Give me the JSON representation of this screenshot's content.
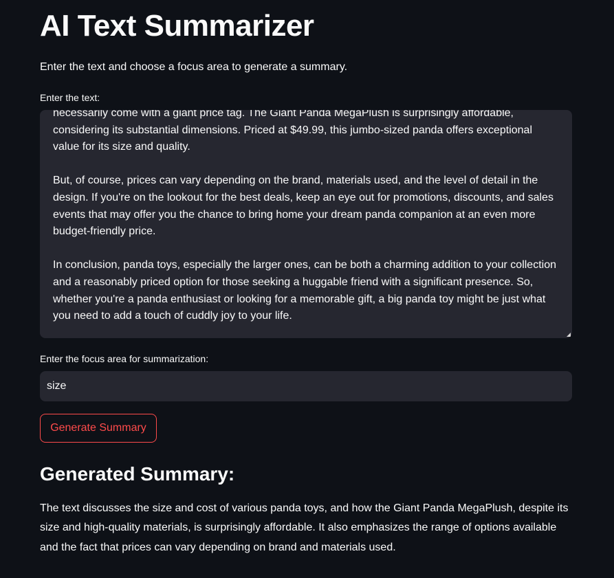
{
  "app": {
    "title": "AI Text Summarizer",
    "intro": "Enter the text and choose a focus area to generate a summary."
  },
  "text_input": {
    "label": "Enter the text:",
    "paragraphs": [
      "necessarily come with a giant price tag. The Giant Panda MegaPlush is surprisingly affordable, considering its substantial dimensions. Priced at $49.99, this jumbo-sized panda offers exceptional value for its size and quality.",
      "But, of course, prices can vary depending on the brand, materials used, and the level of detail in the design. If you're on the lookout for the best deals, keep an eye out for promotions, discounts, and sales events that may offer you the chance to bring home your dream panda companion at an even more budget-friendly price.",
      "In conclusion, panda toys, especially the larger ones, can be both a charming addition to your collection and a reasonably priced option for those seeking a huggable friend with a significant presence. So, whether you're a panda enthusiast or looking for a memorable gift, a big panda toy might be just what you need to add a touch of cuddly joy to your life."
    ]
  },
  "focus_input": {
    "label": "Enter the focus area for summarization:",
    "value": "size"
  },
  "actions": {
    "generate_label": "Generate Summary"
  },
  "result": {
    "heading": "Generated Summary:",
    "text": "The text discusses the size and cost of various panda toys, and how the Giant Panda MegaPlush, despite its size and high-quality materials, is surprisingly affordable. It also emphasizes the range of options available and the fact that prices can vary depending on brand and materials used."
  },
  "colors": {
    "background": "#0e1117",
    "input_background": "#262730",
    "text": "#fafafa",
    "accent": "#ff4b4b"
  }
}
